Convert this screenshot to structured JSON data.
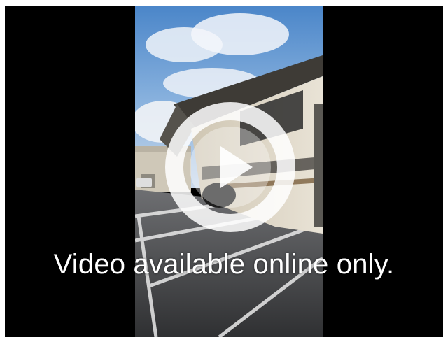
{
  "video": {
    "message": "Video available online only.",
    "play_icon": "play-icon"
  },
  "colors": {
    "letterbox": "#000000",
    "page_background": "#ffffff",
    "overlay": "#ffffff"
  }
}
